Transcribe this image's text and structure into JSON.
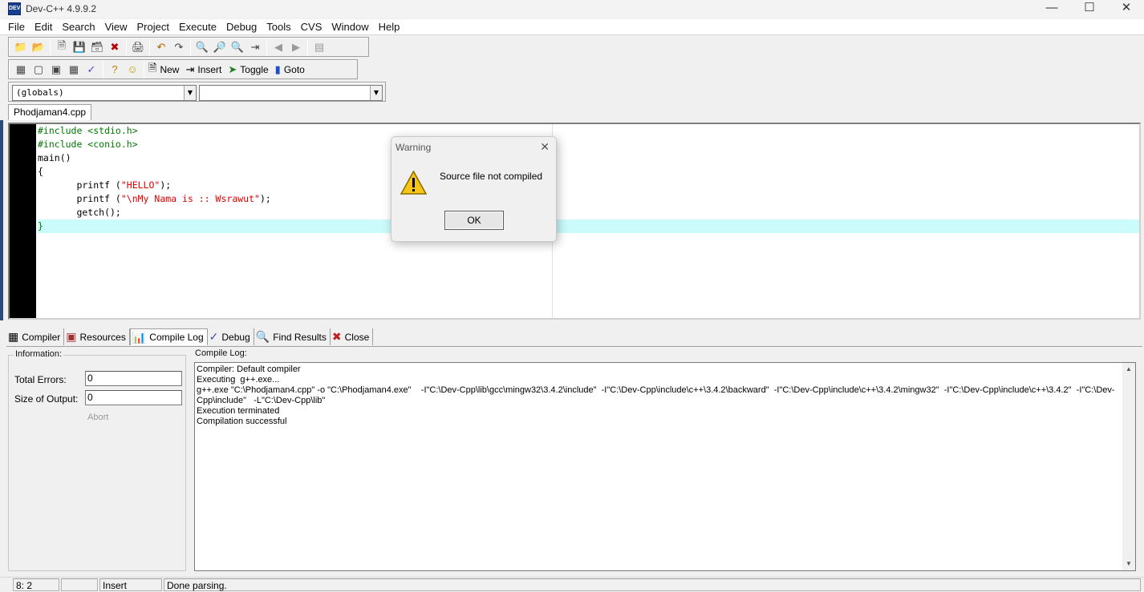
{
  "window": {
    "title": "Dev-C++ 4.9.9.2",
    "icon_label": "DEV"
  },
  "menu": [
    "File",
    "Edit",
    "Search",
    "View",
    "Project",
    "Execute",
    "Debug",
    "Tools",
    "CVS",
    "Window",
    "Help"
  ],
  "toolbar2": {
    "new_label": "New",
    "insert_label": "Insert",
    "toggle_label": "Toggle",
    "goto_label": "Goto"
  },
  "class_combo": {
    "value": "(globals)"
  },
  "member_combo": {
    "value": ""
  },
  "file_tab": "Phodjaman4.cpp",
  "editor": {
    "lines": [
      [
        {
          "t": "#include <stdio.h>",
          "c": "pre"
        }
      ],
      [
        {
          "t": "#include <conio.h>",
          "c": "pre"
        }
      ],
      [
        {
          "t": "main()",
          "c": ""
        }
      ],
      [
        {
          "t": "{",
          "c": ""
        }
      ],
      [
        {
          "t": "       printf (",
          "c": ""
        },
        {
          "t": "\"HELLO\"",
          "c": "str"
        },
        {
          "t": ");",
          "c": ""
        }
      ],
      [
        {
          "t": "       printf (",
          "c": ""
        },
        {
          "t": "\"\\nMy Nama is :: Wsrawut\"",
          "c": "str"
        },
        {
          "t": ");",
          "c": ""
        }
      ],
      [
        {
          "t": "       getch();",
          "c": ""
        }
      ],
      [
        {
          "t": "}",
          "c": "pre"
        }
      ]
    ],
    "active_line": 8
  },
  "bottom_tabs": [
    "Compiler",
    "Resources",
    "Compile Log",
    "Debug",
    "Find Results",
    "Close"
  ],
  "info_panel": {
    "title": "Information:",
    "total_errors_label": "Total Errors:",
    "total_errors_value": "0",
    "size_output_label": "Size of Output:",
    "size_output_value": "0",
    "abort_label": "Abort"
  },
  "compile_log": {
    "title": "Compile Log:",
    "lines": [
      "Compiler: Default compiler",
      "Executing  g++.exe...",
      "g++.exe \"C:\\Phodjaman4.cpp\" -o \"C:\\Phodjaman4.exe\"    -I\"C:\\Dev-Cpp\\lib\\gcc\\mingw32\\3.4.2\\include\"  -I\"C:\\Dev-Cpp\\include\\c++\\3.4.2\\backward\"  -I\"C:\\Dev-Cpp\\include\\c++\\3.4.2\\mingw32\"  -I\"C:\\Dev-Cpp\\include\\c++\\3.4.2\"  -I\"C:\\Dev-Cpp\\include\"   -L\"C:\\Dev-Cpp\\lib\"",
      "Execution terminated",
      "Compilation successful"
    ]
  },
  "status": {
    "position": "8: 2",
    "mode": "Insert",
    "message": "Done parsing."
  },
  "dialog": {
    "title": "Warning",
    "message": "Source file not compiled",
    "ok_label": "OK"
  }
}
